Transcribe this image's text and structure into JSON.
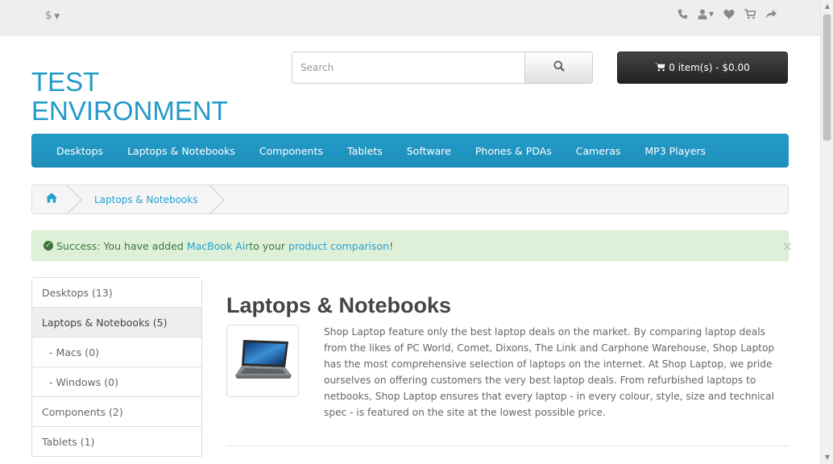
{
  "topbar": {
    "currency": "$",
    "icons": [
      "phone-icon",
      "user-icon",
      "heart-icon",
      "cart-icon",
      "share-icon"
    ]
  },
  "header": {
    "logo_line1": "TEST",
    "logo_line2": "ENVIRONMENT",
    "search_placeholder": "Search",
    "cart_label": "0 item(s) - $0.00"
  },
  "menu": {
    "items": [
      "Desktops",
      "Laptops & Notebooks",
      "Components",
      "Tablets",
      "Software",
      "Phones & PDAs",
      "Cameras",
      "MP3 Players"
    ]
  },
  "breadcrumb": {
    "current": "Laptops & Notebooks"
  },
  "alert": {
    "prefix": "Success: You have added ",
    "product": "MacBook Air",
    "middle": " to your ",
    "link": "product comparison",
    "suffix": "!",
    "close": "×"
  },
  "sidebar": {
    "items": [
      "Desktops (13)",
      "Laptops & Notebooks (5)",
      "- Macs (0)",
      "- Windows (0)",
      "Components (2)",
      "Tablets (1)"
    ]
  },
  "content": {
    "title": "Laptops & Notebooks",
    "description": "Shop Laptop feature only the best laptop deals on the market. By comparing laptop deals from the likes of PC World, Comet, Dixons, The Link and Carphone Warehouse, Shop Laptop has the most comprehensive selection of laptops on the internet. At Shop Laptop, we pride ourselves on offering customers the very best laptop deals. From refurbished laptops to netbooks, Shop Laptop ensures that every laptop - in every colour, style, size and technical spec - is featured on the site at the lowest possible price."
  },
  "colors": {
    "brand": "#229ac8",
    "success_bg": "#dff0d8",
    "success_text": "#3c763d"
  }
}
